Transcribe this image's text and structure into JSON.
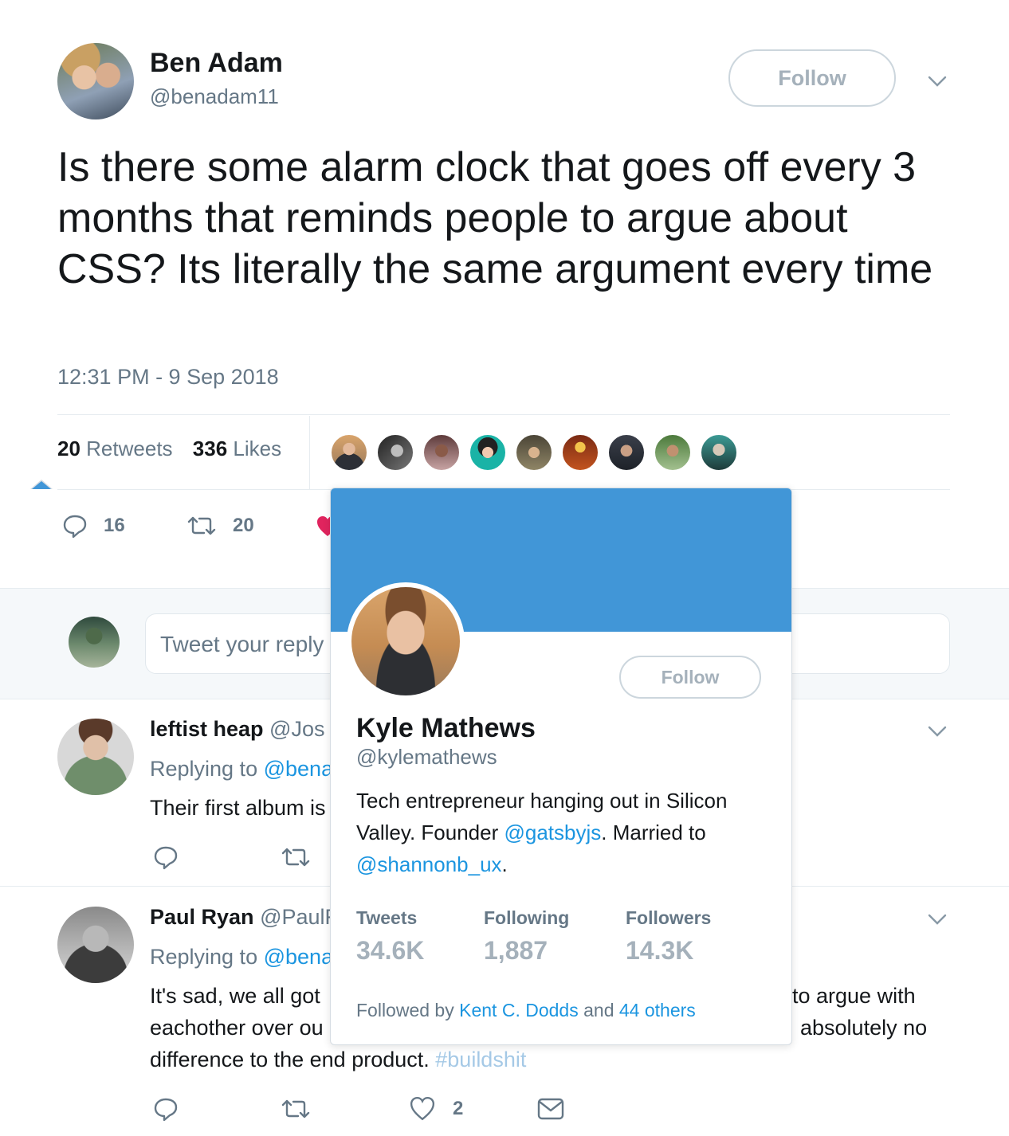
{
  "tweet": {
    "author_name": "Ben Adam",
    "author_handle": "@benadam11",
    "follow_label": "Follow",
    "text": "Is there some alarm clock that goes off every 3 months that reminds people to argue about CSS? Its literally the same argument every time",
    "timestamp": "12:31 PM - 9 Sep 2018",
    "retweets_count": "20",
    "retweets_label": "Retweets",
    "likes_count": "336",
    "likes_label": "Likes",
    "reply_count": "16",
    "retweet_count_action": "20"
  },
  "reply_box": {
    "placeholder": "Tweet your reply"
  },
  "replies": [
    {
      "name": "leftist heap",
      "handle": "@Jos",
      "replying_to": "Replying to",
      "replying_handle": "@bena",
      "text": "Their first album is"
    },
    {
      "name": "Paul Ryan",
      "handle": "@PaulF",
      "replying_to": "Replying to",
      "replying_handle": "@bena",
      "text_line1": "It's sad, we all got",
      "text_line1_right": "to argue with",
      "text_line2": "eachother over ou",
      "text_line2_right": "absolutely no",
      "text_line3": "difference to the end product.",
      "hashtag": "#buildshit",
      "like_count": "2"
    }
  ],
  "hover_card": {
    "follow_label": "Follow",
    "name": "Kyle Mathews",
    "handle": "@kylemathews",
    "bio_1": "Tech entrepreneur hanging out in Silicon",
    "bio_2a": "Valley. Founder ",
    "bio_link1": "@gatsbyjs",
    "bio_2b": ". Married to",
    "bio_link2": "@shannonb_ux",
    "bio_3b": ".",
    "stats": [
      {
        "label": "Tweets",
        "value": "34.6K"
      },
      {
        "label": "Following",
        "value": "1,887"
      },
      {
        "label": "Followers",
        "value": "14.3K"
      }
    ],
    "followed_by_prefix": "Followed by ",
    "followed_by_name": "Kent C. Dodds",
    "followed_by_and": " and ",
    "followed_by_others": "44 others"
  },
  "colors": {
    "link": "#1b95e0",
    "banner": "#4196d7",
    "like_heart": "#e0245e"
  }
}
